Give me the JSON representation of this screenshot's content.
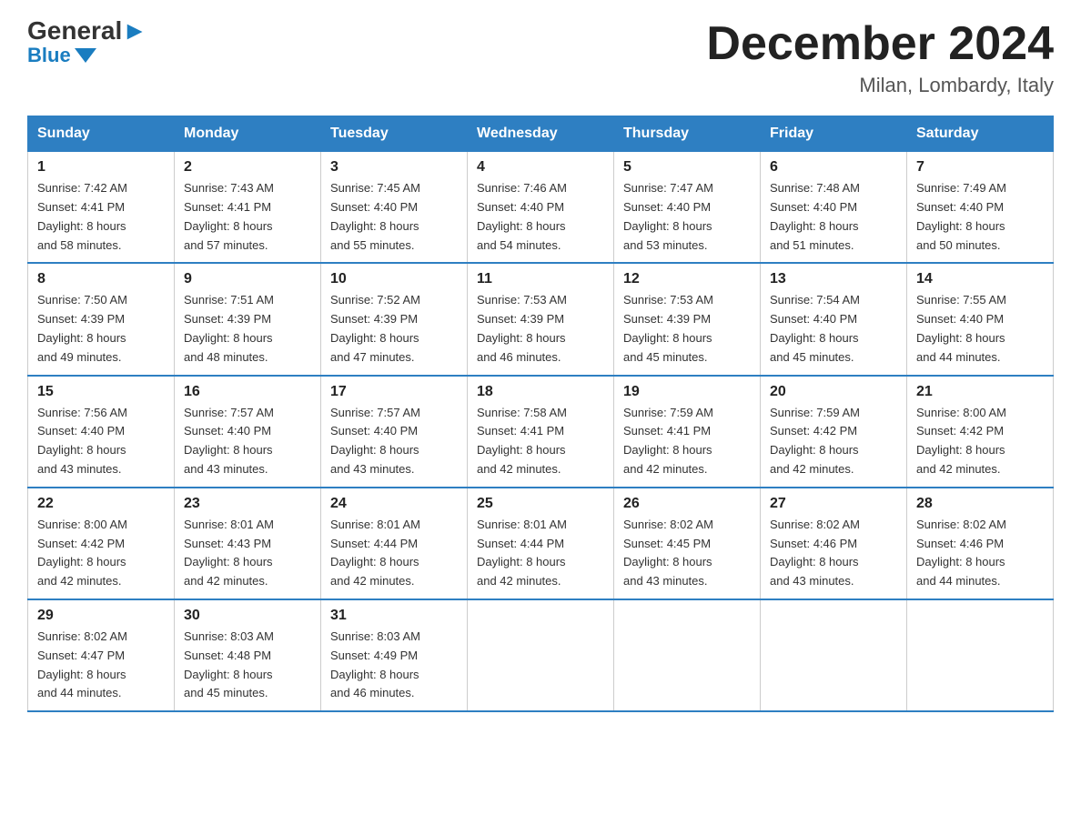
{
  "logo": {
    "general": "General",
    "blue": "Blue"
  },
  "title": "December 2024",
  "location": "Milan, Lombardy, Italy",
  "days_of_week": [
    "Sunday",
    "Monday",
    "Tuesday",
    "Wednesday",
    "Thursday",
    "Friday",
    "Saturday"
  ],
  "weeks": [
    [
      {
        "day": "1",
        "sunrise": "7:42 AM",
        "sunset": "4:41 PM",
        "daylight": "8 hours and 58 minutes."
      },
      {
        "day": "2",
        "sunrise": "7:43 AM",
        "sunset": "4:41 PM",
        "daylight": "8 hours and 57 minutes."
      },
      {
        "day": "3",
        "sunrise": "7:45 AM",
        "sunset": "4:40 PM",
        "daylight": "8 hours and 55 minutes."
      },
      {
        "day": "4",
        "sunrise": "7:46 AM",
        "sunset": "4:40 PM",
        "daylight": "8 hours and 54 minutes."
      },
      {
        "day": "5",
        "sunrise": "7:47 AM",
        "sunset": "4:40 PM",
        "daylight": "8 hours and 53 minutes."
      },
      {
        "day": "6",
        "sunrise": "7:48 AM",
        "sunset": "4:40 PM",
        "daylight": "8 hours and 51 minutes."
      },
      {
        "day": "7",
        "sunrise": "7:49 AM",
        "sunset": "4:40 PM",
        "daylight": "8 hours and 50 minutes."
      }
    ],
    [
      {
        "day": "8",
        "sunrise": "7:50 AM",
        "sunset": "4:39 PM",
        "daylight": "8 hours and 49 minutes."
      },
      {
        "day": "9",
        "sunrise": "7:51 AM",
        "sunset": "4:39 PM",
        "daylight": "8 hours and 48 minutes."
      },
      {
        "day": "10",
        "sunrise": "7:52 AM",
        "sunset": "4:39 PM",
        "daylight": "8 hours and 47 minutes."
      },
      {
        "day": "11",
        "sunrise": "7:53 AM",
        "sunset": "4:39 PM",
        "daylight": "8 hours and 46 minutes."
      },
      {
        "day": "12",
        "sunrise": "7:53 AM",
        "sunset": "4:39 PM",
        "daylight": "8 hours and 45 minutes."
      },
      {
        "day": "13",
        "sunrise": "7:54 AM",
        "sunset": "4:40 PM",
        "daylight": "8 hours and 45 minutes."
      },
      {
        "day": "14",
        "sunrise": "7:55 AM",
        "sunset": "4:40 PM",
        "daylight": "8 hours and 44 minutes."
      }
    ],
    [
      {
        "day": "15",
        "sunrise": "7:56 AM",
        "sunset": "4:40 PM",
        "daylight": "8 hours and 43 minutes."
      },
      {
        "day": "16",
        "sunrise": "7:57 AM",
        "sunset": "4:40 PM",
        "daylight": "8 hours and 43 minutes."
      },
      {
        "day": "17",
        "sunrise": "7:57 AM",
        "sunset": "4:40 PM",
        "daylight": "8 hours and 43 minutes."
      },
      {
        "day": "18",
        "sunrise": "7:58 AM",
        "sunset": "4:41 PM",
        "daylight": "8 hours and 42 minutes."
      },
      {
        "day": "19",
        "sunrise": "7:59 AM",
        "sunset": "4:41 PM",
        "daylight": "8 hours and 42 minutes."
      },
      {
        "day": "20",
        "sunrise": "7:59 AM",
        "sunset": "4:42 PM",
        "daylight": "8 hours and 42 minutes."
      },
      {
        "day": "21",
        "sunrise": "8:00 AM",
        "sunset": "4:42 PM",
        "daylight": "8 hours and 42 minutes."
      }
    ],
    [
      {
        "day": "22",
        "sunrise": "8:00 AM",
        "sunset": "4:42 PM",
        "daylight": "8 hours and 42 minutes."
      },
      {
        "day": "23",
        "sunrise": "8:01 AM",
        "sunset": "4:43 PM",
        "daylight": "8 hours and 42 minutes."
      },
      {
        "day": "24",
        "sunrise": "8:01 AM",
        "sunset": "4:44 PM",
        "daylight": "8 hours and 42 minutes."
      },
      {
        "day": "25",
        "sunrise": "8:01 AM",
        "sunset": "4:44 PM",
        "daylight": "8 hours and 42 minutes."
      },
      {
        "day": "26",
        "sunrise": "8:02 AM",
        "sunset": "4:45 PM",
        "daylight": "8 hours and 43 minutes."
      },
      {
        "day": "27",
        "sunrise": "8:02 AM",
        "sunset": "4:46 PM",
        "daylight": "8 hours and 43 minutes."
      },
      {
        "day": "28",
        "sunrise": "8:02 AM",
        "sunset": "4:46 PM",
        "daylight": "8 hours and 44 minutes."
      }
    ],
    [
      {
        "day": "29",
        "sunrise": "8:02 AM",
        "sunset": "4:47 PM",
        "daylight": "8 hours and 44 minutes."
      },
      {
        "day": "30",
        "sunrise": "8:03 AM",
        "sunset": "4:48 PM",
        "daylight": "8 hours and 45 minutes."
      },
      {
        "day": "31",
        "sunrise": "8:03 AM",
        "sunset": "4:49 PM",
        "daylight": "8 hours and 46 minutes."
      },
      null,
      null,
      null,
      null
    ]
  ],
  "labels": {
    "sunrise": "Sunrise:",
    "sunset": "Sunset:",
    "daylight": "Daylight:"
  }
}
